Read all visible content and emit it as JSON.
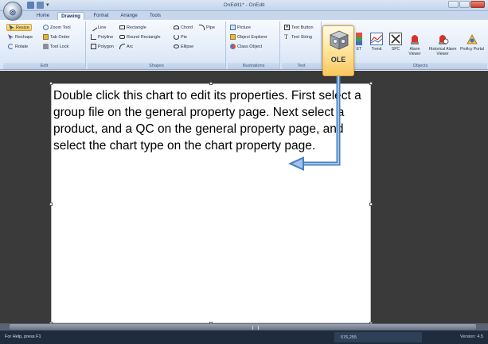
{
  "window": {
    "title": "OnEdit1* - OnEdit",
    "tabs": [
      "Home",
      "Drawing",
      "Format",
      "Arrange",
      "Tools"
    ],
    "active_tab": "Drawing"
  },
  "ribbon": {
    "edit": {
      "label": "Edit",
      "resize": "Resize",
      "zoom_tool": "Zoom Tool",
      "reshape": "Reshape",
      "tab_order": "Tab Order",
      "rotate": "Rotate",
      "tool_lock": "Tool Lock"
    },
    "shapes": {
      "label": "Shapes",
      "line": "Line",
      "rectangle": "Rectangle",
      "chord": "Chord",
      "pipe": "Pipe",
      "polyline": "Polyline",
      "round_rectangle": "Round Rectangle",
      "pie": "Pie",
      "polygon": "Polygon",
      "arc": "Arc",
      "ellipse": "Ellipse"
    },
    "illustrations": {
      "label": "Illustrations",
      "picture": "Picture",
      "object_explorer": "Object Explorer",
      "class_object": "Class Object"
    },
    "text": {
      "label": "Text",
      "text_button": "Text Button",
      "text_string": "Text String"
    },
    "ole": {
      "label": "OLE"
    },
    "objects": {
      "label": "Objects",
      "items": [
        "Trend",
        "SPC",
        "Alarm Viewer",
        "Historical Alarm Viewer",
        "Proficy Portal"
      ],
      "partial_item": "ET"
    }
  },
  "canvas": {
    "message": "Double click this chart to edit its properties.  First select a group file on the general property page.  Next select a product, and a QC on the general property page, and select the chart type on the chart property page."
  },
  "status": {
    "help": "For Help, press F1",
    "position": "576,255",
    "version": "Version: 4.5"
  },
  "colors": {
    "ribbon_bg": "#e4edf9",
    "workspace_bg": "#3a3a3a",
    "highlight": "#f8c85e",
    "arrow": "#5b93d1",
    "status_bg": "#1f2c3e"
  }
}
